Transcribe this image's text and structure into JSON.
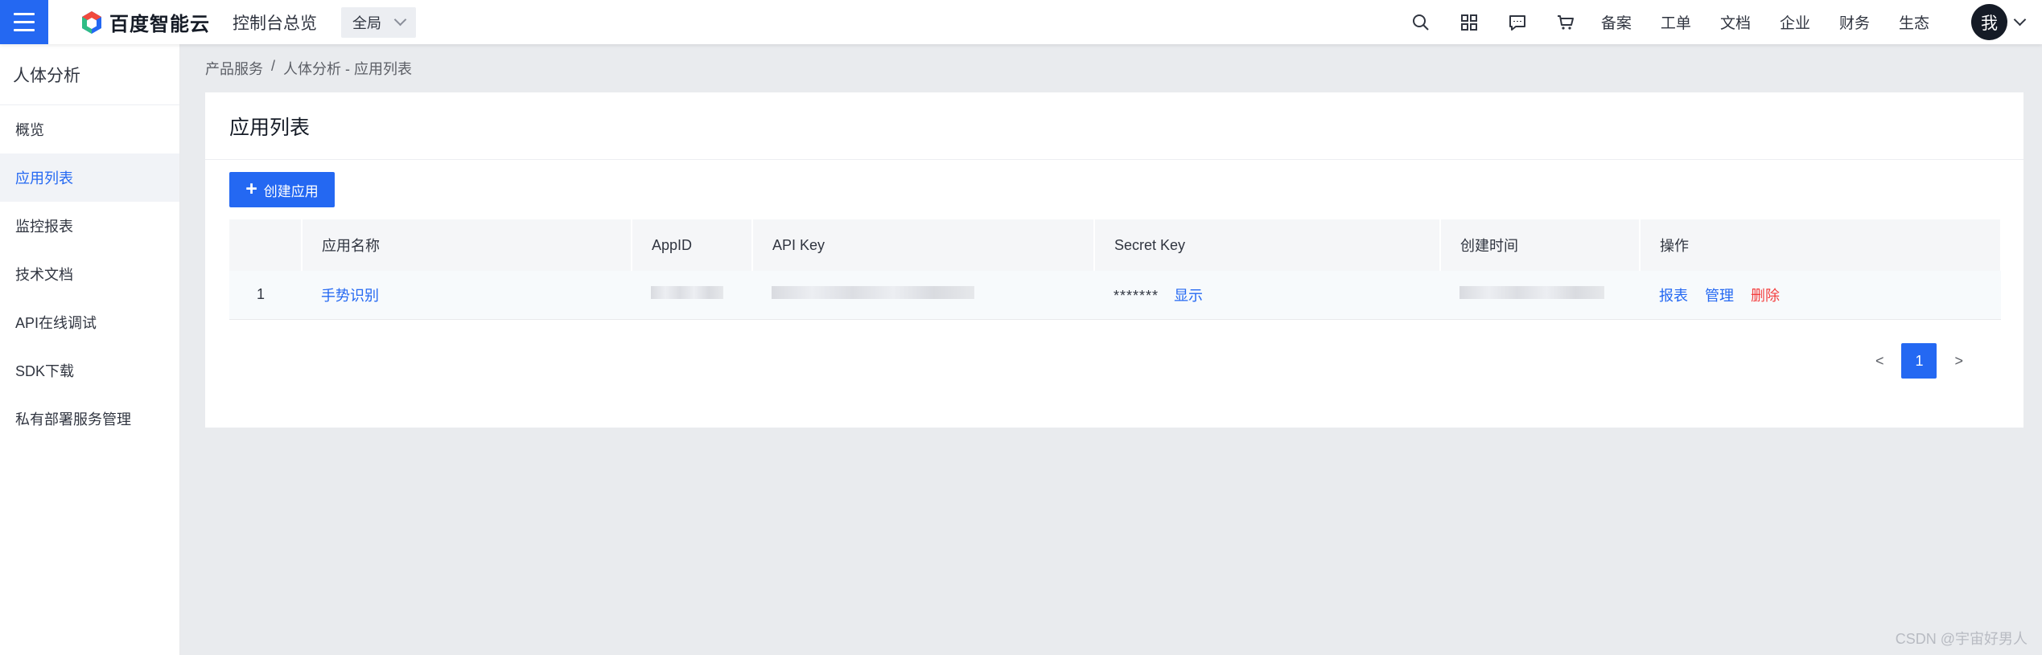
{
  "header": {
    "logo_text": "百度智能云",
    "console_title": "控制台总览",
    "region": "全局",
    "avatar_text": "我",
    "nav_links": [
      "备案",
      "工单",
      "文档",
      "企业",
      "财务",
      "生态"
    ],
    "icons": [
      "search-icon",
      "grid-icon",
      "message-icon",
      "cart-icon"
    ]
  },
  "sidebar": {
    "title": "人体分析",
    "items": [
      {
        "label": "概览"
      },
      {
        "label": "应用列表"
      },
      {
        "label": "监控报表"
      },
      {
        "label": "技术文档"
      },
      {
        "label": "API在线调试"
      },
      {
        "label": "SDK下载"
      },
      {
        "label": "私有部署服务管理"
      }
    ],
    "active_index": 1
  },
  "breadcrumb": {
    "items": [
      "产品服务",
      "人体分析 - 应用列表"
    ],
    "separator": "/"
  },
  "page": {
    "title": "应用列表",
    "create_button": "创建应用"
  },
  "table": {
    "headers": [
      "",
      "应用名称",
      "AppID",
      "API Key",
      "Secret Key",
      "创建时间",
      "操作"
    ],
    "rows": [
      {
        "index": "1",
        "name": "手势识别",
        "secret_key_masked": "*******",
        "show_label": "显示",
        "actions": {
          "report": "报表",
          "manage": "管理",
          "delete": "删除"
        }
      }
    ]
  },
  "pagination": {
    "prev": "<",
    "current": "1",
    "next": ">"
  },
  "watermark": "CSDN @宇宙好男人",
  "colors": {
    "primary": "#2468f2",
    "danger": "#f33e3e",
    "background": "#e9ebee"
  }
}
